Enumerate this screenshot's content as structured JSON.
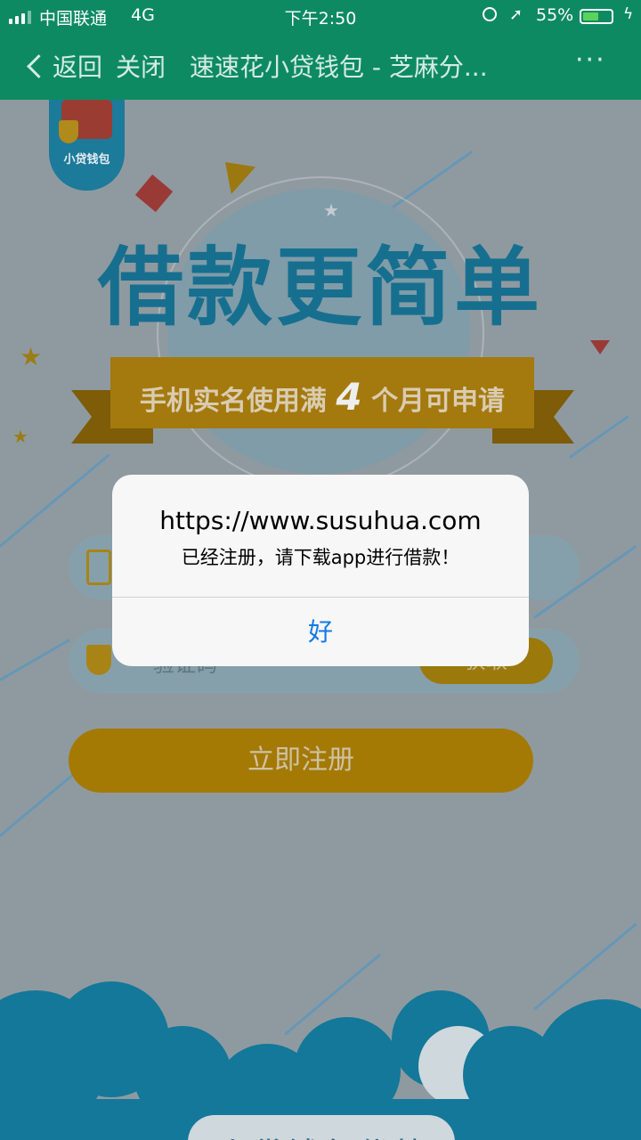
{
  "status_bar": {
    "carrier": "中国联通",
    "network": "4G",
    "time": "下午2:50",
    "battery_percent": "55%",
    "battery_level": 0.55,
    "icons": [
      "signal-icon",
      "orientation-lock-icon",
      "location-icon",
      "battery-icon",
      "charging-icon"
    ]
  },
  "nav": {
    "back_label": "返回",
    "close_label": "关闭",
    "title": "速速花小贷钱包 - 芝麻分...",
    "more_label": "···"
  },
  "page": {
    "logo_text": "小贷钱包",
    "headline": "借款更简单",
    "ribbon_prefix": "手机实名使用满",
    "ribbon_number": "4",
    "ribbon_suffix": "个月可申请",
    "phone_placeholder": "",
    "code_placeholder": "验证码",
    "get_code_label": "获取",
    "register_label": "立即注册",
    "footer_title": "小贷钱包优势"
  },
  "dialog": {
    "title": "https://www.susuhua.com",
    "message": "已经注册，请下载app进行借款！",
    "ok_label": "好"
  },
  "colors": {
    "nav_bg": "#0e8a63",
    "accent_gold": "#a47a05",
    "headline_blue": "#176f8f",
    "dialog_button_blue": "#1479e6"
  }
}
